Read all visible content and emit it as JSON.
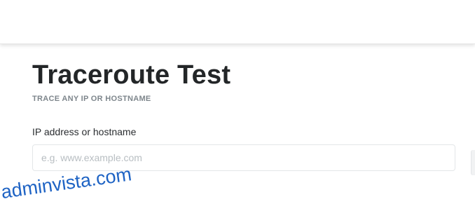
{
  "page": {
    "title": "Traceroute Test",
    "subtitle": "TRACE ANY IP OR HOSTNAME"
  },
  "form": {
    "host_label": "IP address or hostname",
    "host_placeholder": "e.g. www.example.com",
    "host_value": ""
  },
  "watermark": {
    "text": "adminvista.com"
  },
  "colors": {
    "title": "#232628",
    "subtitle": "#7e868c",
    "input_border": "#e3e6e8",
    "placeholder": "#b8bec2",
    "watermark": "#1e63c4"
  }
}
